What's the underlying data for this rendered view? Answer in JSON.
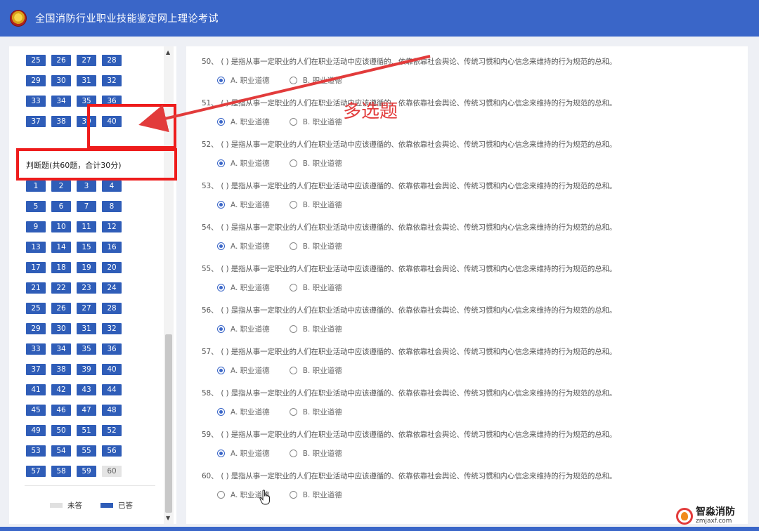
{
  "header": {
    "title": "全国消防行业职业技能鉴定网上理论考试"
  },
  "sidebar": {
    "top_numbers": [
      "25",
      "26",
      "27",
      "28",
      "29",
      "30",
      "31",
      "32",
      "33",
      "34",
      "35",
      "36",
      "37",
      "38",
      "39",
      "40"
    ],
    "section_title": "判断题(共60题，合计30分)",
    "section_numbers": [
      "1",
      "2",
      "3",
      "4",
      "5",
      "6",
      "7",
      "8",
      "9",
      "10",
      "11",
      "12",
      "13",
      "14",
      "15",
      "16",
      "17",
      "18",
      "19",
      "20",
      "21",
      "22",
      "23",
      "24",
      "25",
      "26",
      "27",
      "28",
      "29",
      "30",
      "31",
      "32",
      "33",
      "34",
      "35",
      "36",
      "37",
      "38",
      "39",
      "40",
      "41",
      "42",
      "43",
      "44",
      "45",
      "46",
      "47",
      "48",
      "49",
      "50",
      "51",
      "52",
      "53",
      "54",
      "55",
      "56",
      "57",
      "58",
      "59",
      "60"
    ],
    "unanswered_number": "60",
    "legend": {
      "unanswered_label": "未答",
      "answered_label": "已答"
    }
  },
  "questions": {
    "text": "( ) 是指从事一定职业的人们在职业活动中应该遵循的、依靠依靠社会舆论、传统习惯和内心信念来维持的行为规范的总和。",
    "option_a": "A. 职业道德",
    "option_b": "B. 职业道德",
    "items": [
      {
        "number": "50、",
        "selected": "A"
      },
      {
        "number": "51、",
        "selected": "A"
      },
      {
        "number": "52、",
        "selected": "A"
      },
      {
        "number": "53、",
        "selected": "A"
      },
      {
        "number": "54、",
        "selected": "A"
      },
      {
        "number": "55、",
        "selected": "A"
      },
      {
        "number": "56、",
        "selected": "A"
      },
      {
        "number": "57、",
        "selected": "A"
      },
      {
        "number": "58、",
        "selected": "A"
      },
      {
        "number": "59、",
        "selected": "A"
      },
      {
        "number": "60、",
        "selected": ""
      }
    ]
  },
  "annotation": {
    "label": "多选题",
    "color": "#e23b3b"
  },
  "watermark": {
    "name": "智淼消防",
    "url": "zmjaxf.com"
  },
  "colors": {
    "header": "#3a66c8",
    "answered": "#2f5db8",
    "unanswered": "#e4e4e4"
  }
}
